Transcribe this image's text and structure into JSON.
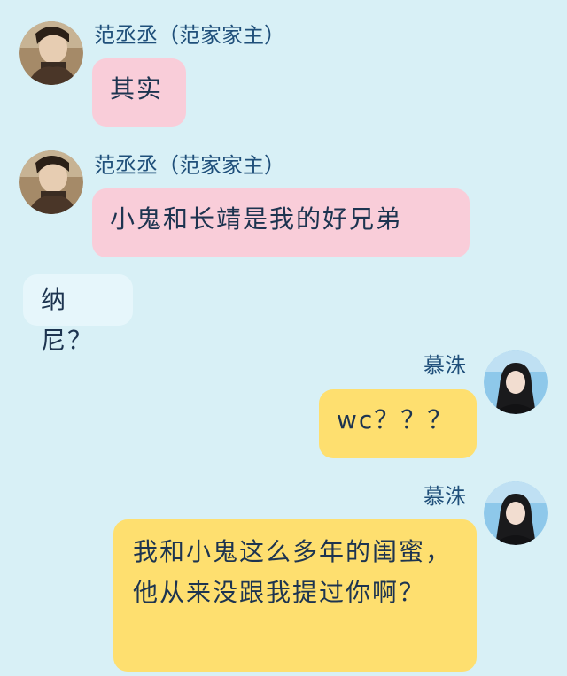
{
  "messages": [
    {
      "sender": "范丞丞（范家家主）",
      "text": "其实"
    },
    {
      "sender": "范丞丞（范家家主）",
      "text": "小鬼和长靖是我的好兄弟"
    },
    {
      "sender": "",
      "text": "纳尼？"
    },
    {
      "sender": "慕洙",
      "text": "wc？？？"
    },
    {
      "sender": "慕洙",
      "text": "我和小鬼这么多年的闺蜜，他从来没跟我提过你啊？"
    }
  ]
}
